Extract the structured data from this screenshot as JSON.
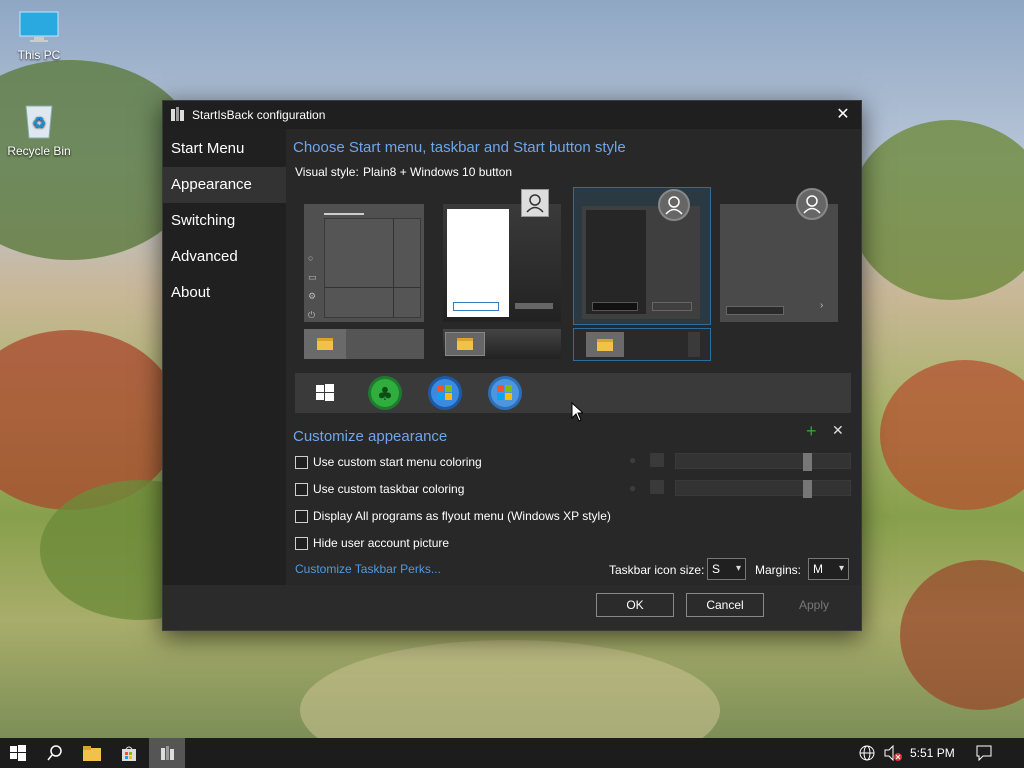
{
  "desktop": {
    "icons": [
      {
        "label": "This PC",
        "icon": "computer-icon"
      },
      {
        "label": "Recycle Bin",
        "icon": "recycle-bin-icon"
      }
    ]
  },
  "window": {
    "title": "StartIsBack configuration",
    "nav": [
      "Start Menu",
      "Appearance",
      "Switching",
      "Advanced",
      "About"
    ],
    "active_nav": "Appearance",
    "section1_title": "Choose Start menu, taskbar and Start button style",
    "visual_style_label": "Visual style:",
    "visual_style_value": "Plain8 + Windows 10 button",
    "start_buttons": [
      "windows10-logo-icon",
      "clover-orb-icon",
      "windows7-orb-icon",
      "windows-orb-icon"
    ],
    "section2_title": "Customize appearance",
    "checkboxes": [
      {
        "label": "Use custom start menu coloring",
        "checked": false
      },
      {
        "label": "Use custom taskbar coloring",
        "checked": false
      },
      {
        "label": "Display All programs as flyout menu (Windows XP style)",
        "checked": false
      },
      {
        "label": "Hide user account picture",
        "checked": false
      }
    ],
    "link": "Customize Taskbar Perks...",
    "icon_size_label": "Taskbar icon size:",
    "icon_size_value": "S",
    "margins_label": "Margins:",
    "margins_value": "M",
    "buttons": {
      "ok": "OK",
      "cancel": "Cancel",
      "apply": "Apply"
    }
  },
  "taskbar": {
    "time": "5:51 PM"
  },
  "colors": {
    "accent": "#6ea6ea",
    "link": "#4f9be0"
  }
}
